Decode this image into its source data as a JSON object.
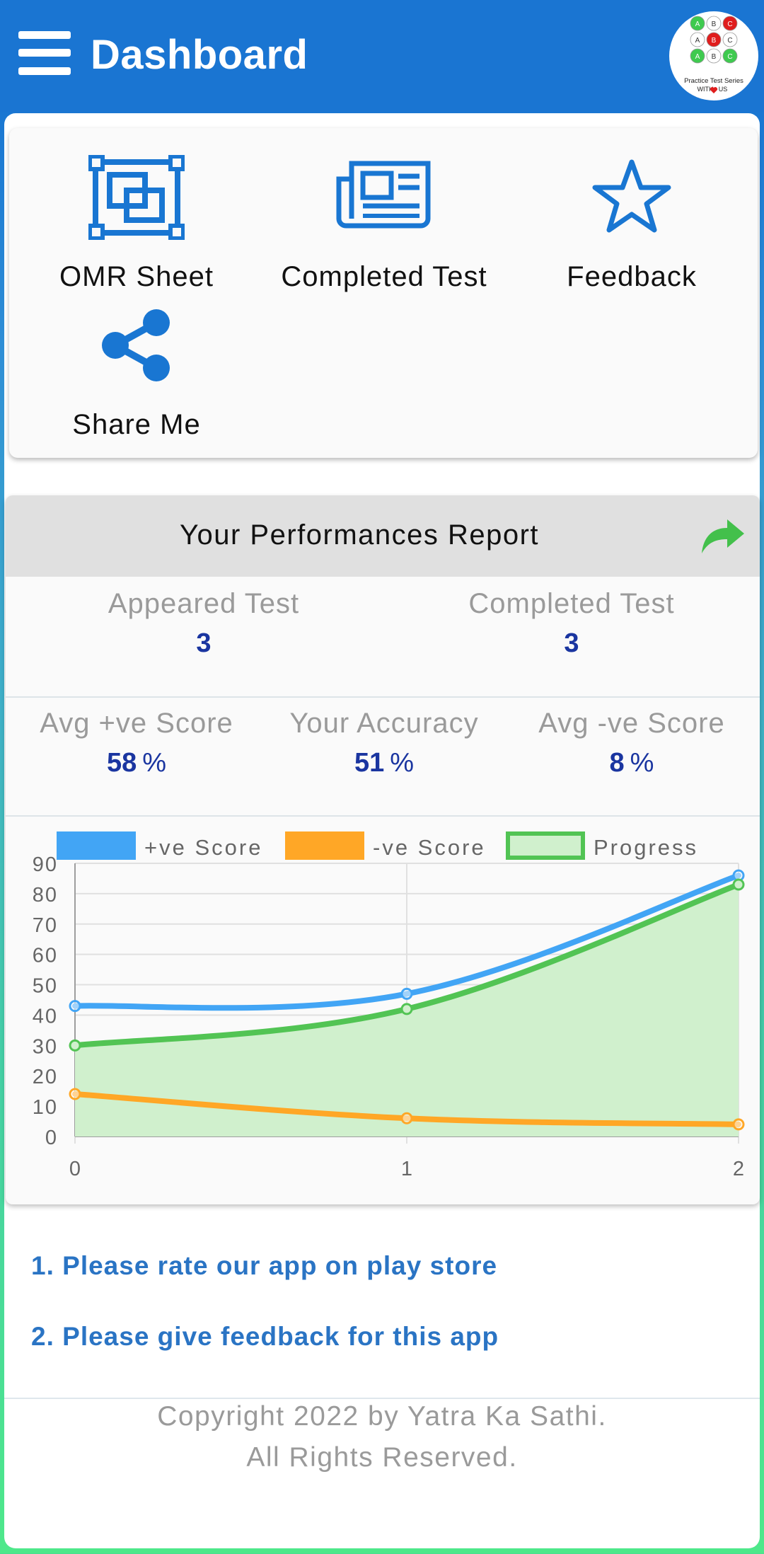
{
  "appbar": {
    "title": "Dashboard"
  },
  "logo": {
    "circles": [
      {
        "letter": "A",
        "color": "#3fca4f",
        "text_color": "#ffffff"
      },
      {
        "letter": "B",
        "color": "#ffffff",
        "text_color": "#333333"
      },
      {
        "letter": "C",
        "color": "#e01d1d",
        "text_color": "#ffffff"
      },
      {
        "letter": "A",
        "color": "#ffffff",
        "text_color": "#333333"
      },
      {
        "letter": "B",
        "color": "#e01d1d",
        "text_color": "#ffffff"
      },
      {
        "letter": "C",
        "color": "#ffffff",
        "text_color": "#333333"
      },
      {
        "letter": "A",
        "color": "#3fca4f",
        "text_color": "#ffffff"
      },
      {
        "letter": "B",
        "color": "#ffffff",
        "text_color": "#333333"
      },
      {
        "letter": "C",
        "color": "#3fca4f",
        "text_color": "#ffffff"
      }
    ],
    "line1": "Practice Test Series",
    "line2a": "WITH",
    "line2b": "US"
  },
  "menu": {
    "omr_sheet": "OMR Sheet",
    "completed_test": "Completed Test",
    "feedback": "Feedback",
    "share_me": "Share Me"
  },
  "performance": {
    "title": "Your Performances Report",
    "appeared_label": "Appeared Test",
    "appeared_value": "3",
    "completed_label": "Completed Test",
    "completed_value": "3",
    "avg_pos_label": "Avg +ve Score",
    "avg_pos_value": "58",
    "accuracy_label": "Your Accuracy",
    "accuracy_value": "51",
    "avg_neg_label": "Avg -ve Score",
    "avg_neg_value": "8",
    "percent": "%"
  },
  "chart_data": {
    "type": "line",
    "x": [
      0,
      1,
      2
    ],
    "series": [
      {
        "name": "+ve Score",
        "values": [
          43,
          47,
          86
        ],
        "color": "#42a5f5",
        "fill": false
      },
      {
        "name": "-ve Score",
        "values": [
          14,
          6,
          4
        ],
        "color": "#ffa726",
        "fill": false
      },
      {
        "name": "Progress",
        "values": [
          30,
          42,
          83
        ],
        "color": "#52c454",
        "fill": true,
        "fill_color": "#d0f0cd"
      }
    ],
    "xlim": [
      0,
      2
    ],
    "ylim": [
      0,
      90
    ],
    "yticks": [
      0,
      10,
      20,
      30,
      40,
      50,
      60,
      70,
      80,
      90
    ],
    "xticks": [
      0,
      1,
      2
    ],
    "grid": true,
    "legend": "top"
  },
  "links": {
    "rate": "1. Please rate our app on play store",
    "feedback": "2. Please give feedback for this app"
  },
  "footer": {
    "line1": "Copyright 2022 by Yatra Ka Sathi.",
    "line2": "All Rights Reserved."
  }
}
